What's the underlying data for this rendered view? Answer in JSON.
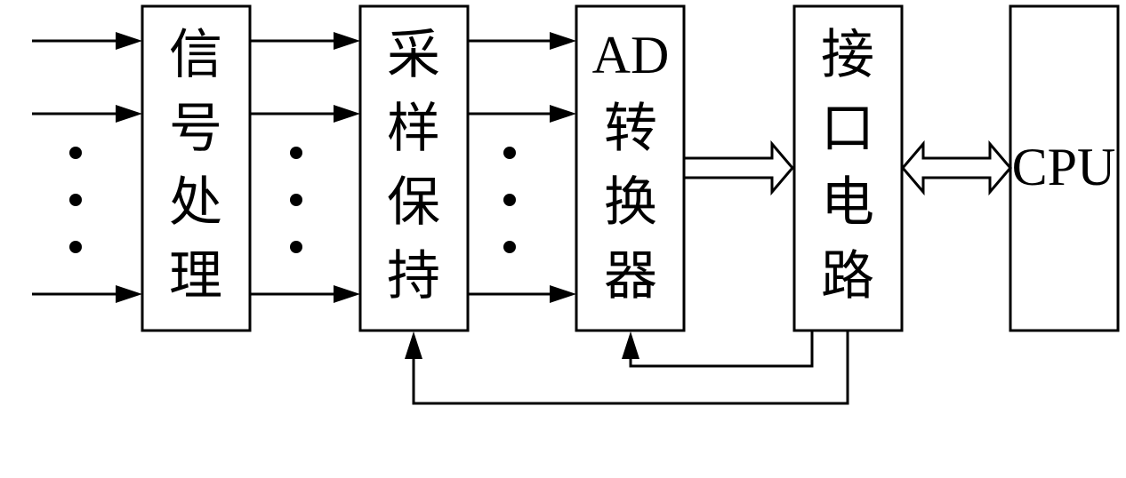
{
  "blocks": {
    "signal": {
      "chars": [
        "信",
        "号",
        "处",
        "理"
      ]
    },
    "sample_hold": {
      "chars": [
        "采",
        "样",
        "保",
        "持"
      ]
    },
    "ad": {
      "chars": [
        "AD",
        "转",
        "换",
        "器"
      ]
    },
    "interface": {
      "chars": [
        "接",
        "口",
        "电",
        "路"
      ]
    },
    "cpu": {
      "label": "CPU"
    }
  },
  "colors": {
    "stroke": "#000000",
    "background": "#ffffff"
  }
}
